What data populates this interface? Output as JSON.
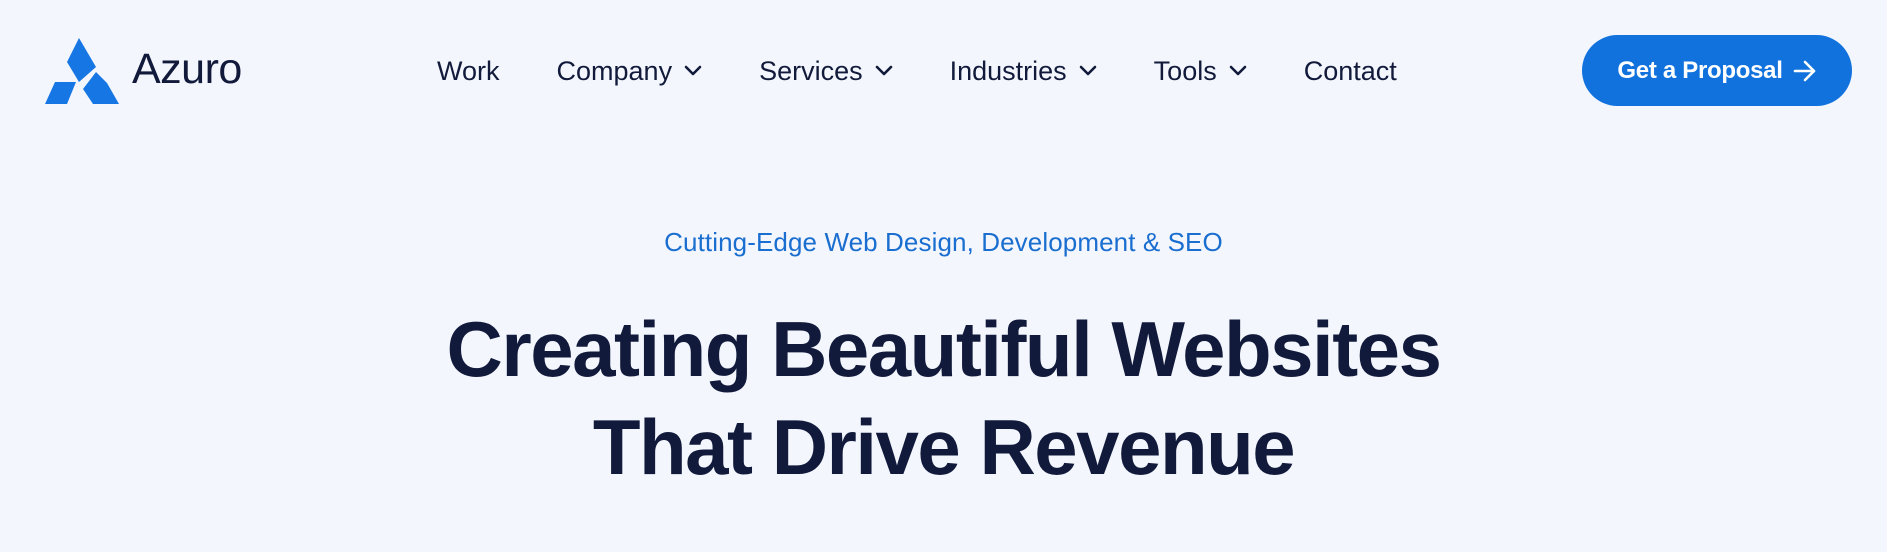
{
  "brand": {
    "name": "Azuro",
    "logo_icon": "triangle-logo-icon",
    "accent_color": "#1172dd"
  },
  "nav": {
    "items": [
      {
        "label": "Work",
        "has_dropdown": false
      },
      {
        "label": "Company",
        "has_dropdown": true
      },
      {
        "label": "Services",
        "has_dropdown": true
      },
      {
        "label": "Industries",
        "has_dropdown": true
      },
      {
        "label": "Tools",
        "has_dropdown": true
      },
      {
        "label": "Contact",
        "has_dropdown": false
      }
    ],
    "dropdown_icon": "chevron-down-icon"
  },
  "cta": {
    "label": "Get a Proposal",
    "icon": "arrow-right-icon"
  },
  "hero": {
    "eyebrow": "Cutting-Edge Web Design, Development & SEO",
    "headline_line1": "Creating Beautiful Websites",
    "headline_line2": "That Drive Revenue"
  }
}
